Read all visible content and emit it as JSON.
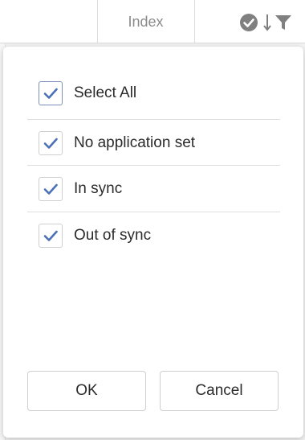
{
  "grid_header": {
    "index_label": "Index",
    "icons": [
      "check-circle-icon",
      "sort-down-arrow-icon",
      "filter-funnel-icon"
    ]
  },
  "filter_dialog": {
    "options": [
      {
        "label": "Select All",
        "checked": true
      },
      {
        "label": "No application set",
        "checked": true
      },
      {
        "label": "In sync",
        "checked": true
      },
      {
        "label": "Out of sync",
        "checked": true
      }
    ],
    "ok_label": "OK",
    "cancel_label": "Cancel"
  },
  "colors": {
    "check_accent": "#4a70b8",
    "icon_gray": "#808080",
    "text": "#2b2b2b"
  }
}
